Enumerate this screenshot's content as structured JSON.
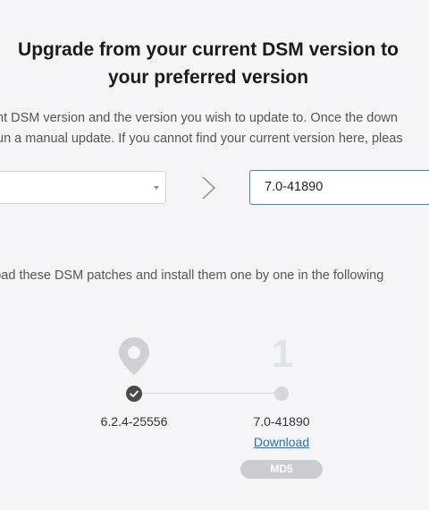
{
  "header": {
    "title_line1": "Upgrade from your current DSM version to",
    "title_line2": "your preferred version"
  },
  "description": {
    "line1": "nt DSM version and the version you wish to update to. Once the down",
    "line2": "un a manual update. If you cannot find your current version here, pleas"
  },
  "selectors": {
    "current_version_value": "",
    "target_version_value": "7.0-41890"
  },
  "instruction": "load these DSM patches and install them one by one in the following",
  "timeline": {
    "step_number": "1",
    "current_version": "6.2.4-25556",
    "target_version": "7.0-41890",
    "download_label": "Download",
    "md5_label": "MD5"
  },
  "icons": {
    "pin": "location-pin-icon",
    "check": "check-circle-icon",
    "arrow": "chevron-right-icon",
    "caret": "caret-down-icon"
  },
  "colors": {
    "accent": "#3b82d6",
    "link": "#1a73c8",
    "pin": "#cfd0d3",
    "check_dot": "#4a4a4a",
    "step_dot": "#d6d7da"
  }
}
